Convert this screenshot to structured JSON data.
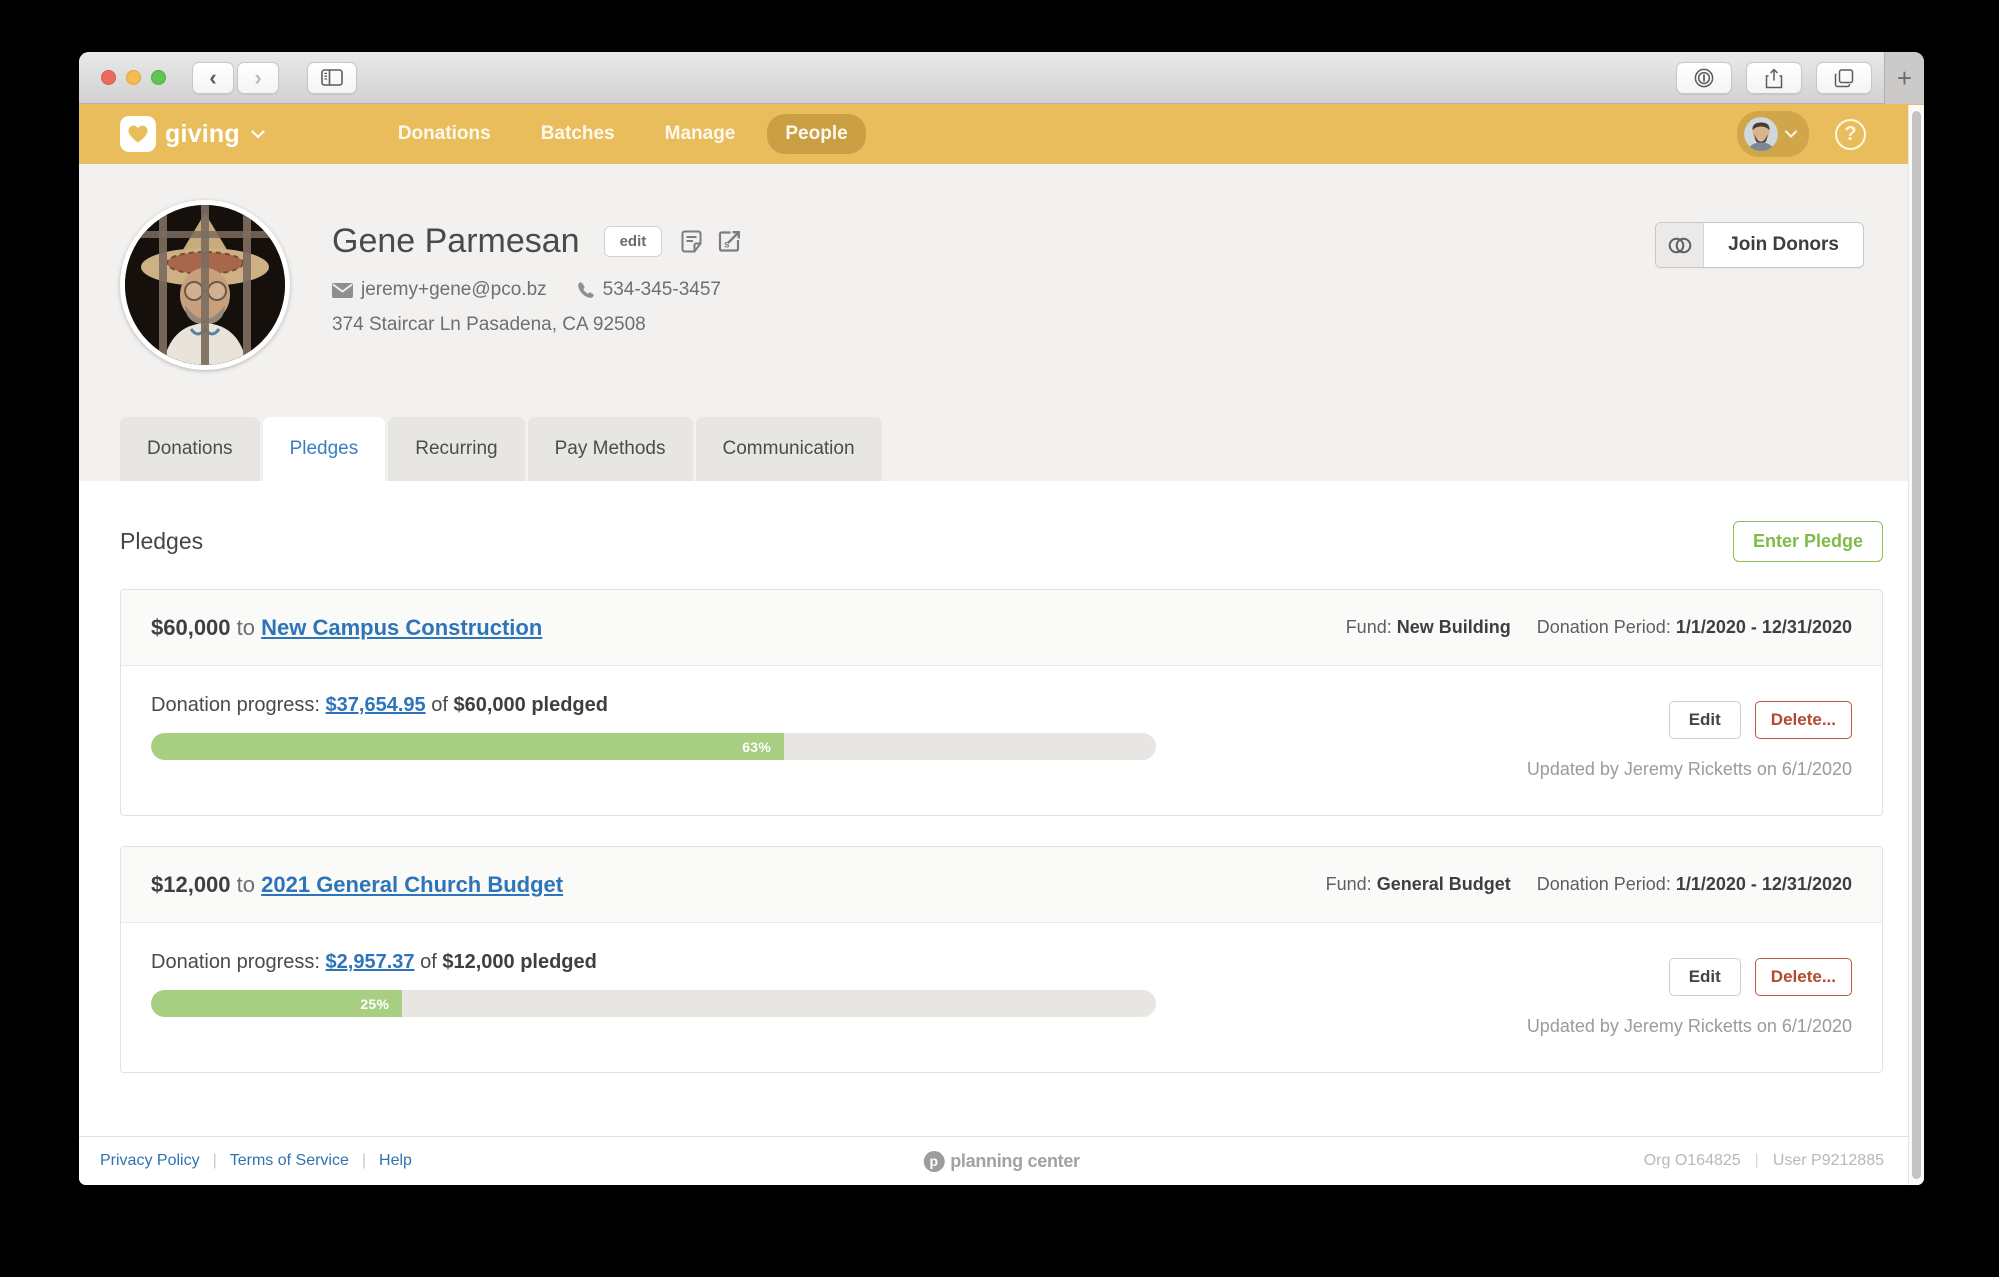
{
  "browser": {
    "new_tab_label": "+",
    "back_glyph": "‹",
    "forward_glyph": "›"
  },
  "app_header": {
    "brand": "giving",
    "nav": [
      {
        "label": "Donations",
        "active": false
      },
      {
        "label": "Batches",
        "active": false
      },
      {
        "label": "Manage",
        "active": false
      },
      {
        "label": "People",
        "active": true
      }
    ],
    "help_glyph": "?"
  },
  "profile": {
    "name": "Gene Parmesan",
    "edit_button": "edit",
    "email": "jeremy+gene@pco.bz",
    "phone": "534-345-3457",
    "address": "374 Staircar Ln Pasadena, CA 92508",
    "join_donors_button": "Join Donors"
  },
  "tabs": [
    {
      "label": "Donations",
      "active": false
    },
    {
      "label": "Pledges",
      "active": true
    },
    {
      "label": "Recurring",
      "active": false
    },
    {
      "label": "Pay Methods",
      "active": false
    },
    {
      "label": "Communication",
      "active": false
    }
  ],
  "pledges": {
    "section_title": "Pledges",
    "enter_pledge_button": "Enter Pledge",
    "items": [
      {
        "amount": "$60,000",
        "to_word": "to",
        "campaign": "New Campus Construction",
        "fund_label": "Fund:",
        "fund": "New Building",
        "period_label": "Donation Period:",
        "period": "1/1/2020 - 12/31/2020",
        "progress_label": "Donation progress:",
        "donated": "$37,654.95",
        "of_word": "of",
        "pledged": "$60,000 pledged",
        "percent": 63,
        "percent_label": "63%",
        "edit_button": "Edit",
        "delete_button": "Delete...",
        "updated": "Updated by Jeremy Ricketts on 6/1/2020"
      },
      {
        "amount": "$12,000",
        "to_word": "to",
        "campaign": "2021 General Church Budget",
        "fund_label": "Fund:",
        "fund": "General Budget",
        "period_label": "Donation Period:",
        "period": "1/1/2020 - 12/31/2020",
        "progress_label": "Donation progress:",
        "donated": "$2,957.37",
        "of_word": "of",
        "pledged": "$12,000 pledged",
        "percent": 25,
        "percent_label": "25%",
        "edit_button": "Edit",
        "delete_button": "Delete...",
        "updated": "Updated by Jeremy Ricketts on 6/1/2020"
      }
    ]
  },
  "footer": {
    "links": [
      {
        "label": "Privacy Policy"
      },
      {
        "label": "Terms of Service"
      },
      {
        "label": "Help"
      }
    ],
    "brand": "planning center",
    "brand_initial": "p",
    "org": "Org O164825",
    "user": "User P9212885"
  },
  "colors": {
    "header_yellow": "#e9bd5b",
    "accent_blue": "#2e74b8",
    "accent_green": "#8cc152",
    "progress_green": "#a7ce81",
    "delete_red": "#b14a31"
  }
}
